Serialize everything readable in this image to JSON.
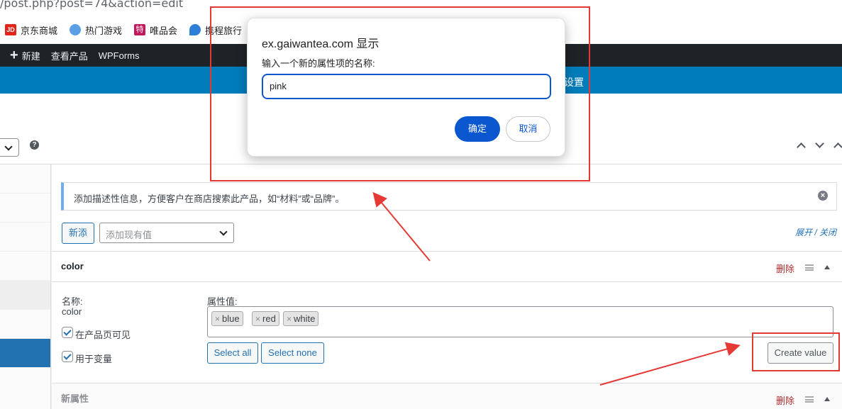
{
  "browser": {
    "url_fragment": "/post.php?post=74&action=edit",
    "bookmarks": [
      {
        "label": "京东商城",
        "icon": "jd-icon"
      },
      {
        "label": "热门游戏",
        "icon": "game-icon"
      },
      {
        "label": "唯品会",
        "icon": "vip-icon"
      },
      {
        "label": "携程旅行",
        "icon": "ctrip-icon"
      }
    ]
  },
  "adminbar": {
    "plus": "+",
    "new_label": "新建",
    "view_product": "查看产品",
    "wpforms": "WPForms"
  },
  "bluebar": {
    "text": "设置"
  },
  "dialog": {
    "title": "ex.gaiwantea.com 显示",
    "message": "输入一个新的属性项的名称:",
    "input_value": "pink",
    "ok_label": "确定",
    "cancel_label": "取消"
  },
  "notice": {
    "text": "添加描述性信息，方便客户在商店搜索此产品，如“材料”或“品牌”。",
    "close": "×"
  },
  "toolbar": {
    "add_label": "新添",
    "select_placeholder": "添加现有值",
    "expand_label": "展开 / 关闭",
    "help": "?"
  },
  "attribute": {
    "name": "color",
    "delete_label": "删除",
    "name_label": "名称:",
    "name_value": "color",
    "visible_label": "在产品页可见",
    "variation_label": "用于变量",
    "values_label": "属性值:",
    "values": [
      "blue",
      "red",
      "white"
    ],
    "token_remove": "×",
    "select_all": "Select all",
    "select_none": "Select none",
    "create_value": "Create value"
  },
  "new_attribute": {
    "name": "新属性",
    "delete_label": "删除"
  },
  "colors": {
    "admin_dark": "#1d2327",
    "wp_blue": "#007cba",
    "link_blue": "#2271b1",
    "dialog_blue": "#0b57d0",
    "delete_red": "#b32d2e",
    "annotation_red": "#e53935"
  }
}
